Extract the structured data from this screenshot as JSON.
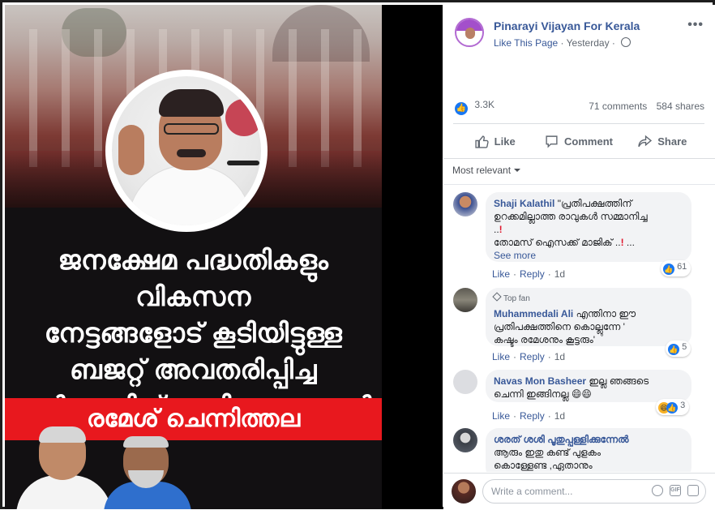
{
  "poster": {
    "headline_lines": [
      "ജനക്ഷേമ പദ്ധതികളും വികസന",
      "നേട്ടങ്ങളോട് കൂടിയിട്ടുള്ള",
      "ബജറ്റ് അവതരിപ്പിച്ച",
      "സർക്കാരിന് അഭിനന്ദനങ്ങൾ"
    ],
    "name_banner": "രമേശ് ചെന്നിത്തല"
  },
  "post": {
    "page_name": "Pinarayi Vijayan For Kerala",
    "like_page_label": "Like This Page",
    "time": "Yesterday",
    "more_label": "•••",
    "reaction_count": "3.3K",
    "comments_count": "71 comments",
    "shares_count": "584 shares",
    "actions": {
      "like": "Like",
      "comment": "Comment",
      "share": "Share"
    },
    "sort_label": "Most relevant"
  },
  "comments": [
    {
      "author": "Shaji Kalathil",
      "text_1": "\"പ്രതിപക്ഷത്തിന്",
      "text_2": "ഉറക്കമില്ലാത്ത രാവുകൾ സമ്മാനിച്ച",
      "text_3": "..",
      "text_4": "തോമസ് ഐസക്ക് മാജിക് ..",
      "text_5": " ...",
      "see_more": "See more",
      "like": "Like",
      "reply": "Reply",
      "time": "1d",
      "reactions": "61"
    },
    {
      "badge": "Top fan",
      "author": "Muhammedali Ali",
      "text_1": "എന്തിനാ ഈ",
      "text_2": "പ്രതിപക്ഷത്തിനെ കൊല്ലുന്നേ '",
      "text_3": "കഷ്ടം രമേശനും കൂട്ടരും'",
      "like": "Like",
      "reply": "Reply",
      "time": "1d",
      "reactions": "5"
    },
    {
      "author": "Navas Mon Basheer",
      "text_1": "ഇല്ല ഞങ്ങടെ",
      "text_2": "ചെന്നി ഇങ്ങിനല്ല 😄😄",
      "like": "Like",
      "reply": "Reply",
      "time": "1d",
      "reactions": "3"
    },
    {
      "author": "ശരത് ശശി പൂതുപ്പള്ളിക്കുന്നേൽ",
      "text_1": "ആരും ഇതു കണ്ട് പുളകം",
      "text_2": "കൊള്ളേണ്ട ,ഏതാനും"
    }
  ],
  "composer": {
    "placeholder": "Write a comment..."
  },
  "icons": [
    "like-icon",
    "comment-icon",
    "share-icon",
    "globe-icon",
    "caret-down-icon",
    "emoji-icon",
    "gif-icon",
    "sticker-icon",
    "more-icon"
  ],
  "colors": {
    "link": "#385898",
    "accent": "#1877f2",
    "banner_red": "#e8181e"
  }
}
